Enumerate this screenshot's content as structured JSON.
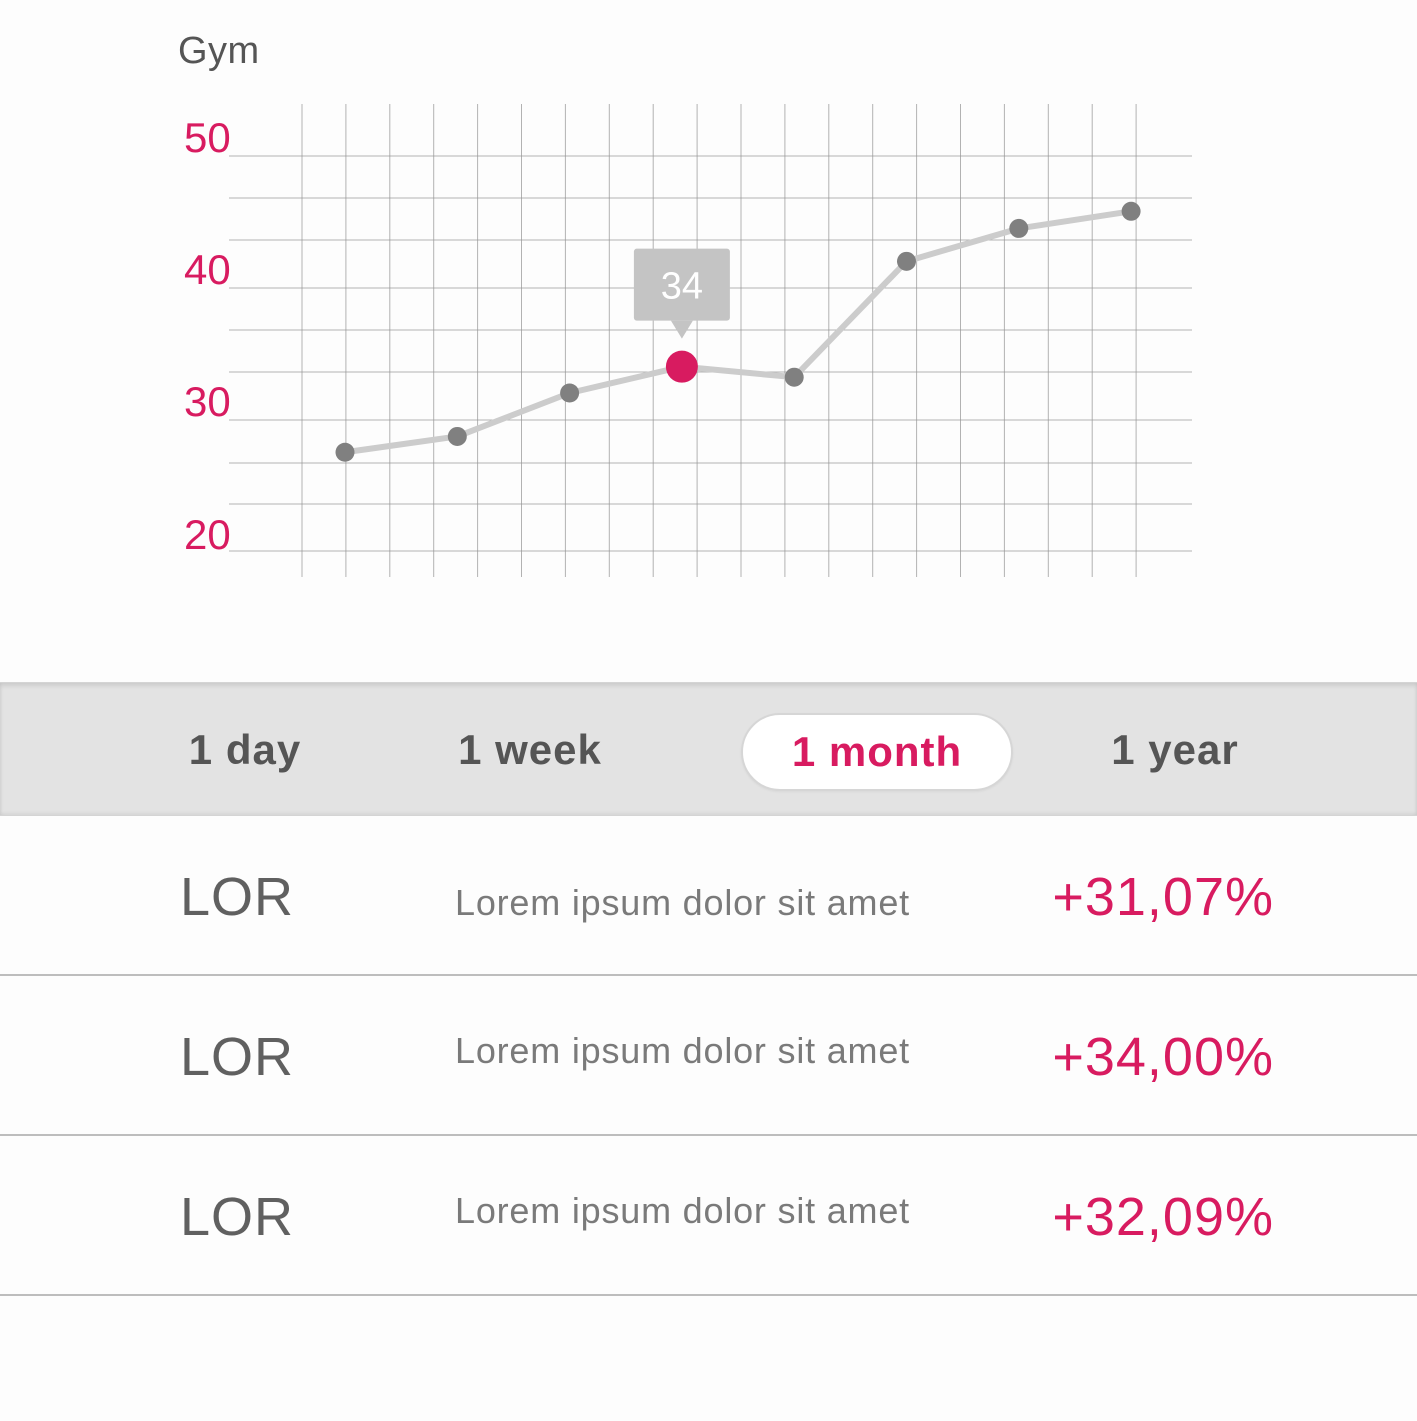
{
  "chart": {
    "title": "Gym",
    "accent_color": "#d81b60",
    "line_color": "#cccccc",
    "point_color": "#808080",
    "grid_color": "#999999"
  },
  "chart_data": {
    "type": "line",
    "title": "Gym",
    "xlabel": "",
    "ylabel": "",
    "y_ticks": [
      "50",
      "40",
      "30",
      "20"
    ],
    "ylim": [
      20,
      50
    ],
    "x": [
      1,
      2,
      3,
      4,
      5,
      6,
      7,
      8
    ],
    "values": [
      27.5,
      28.7,
      32.0,
      34.0,
      33.2,
      42.0,
      44.5,
      45.8
    ],
    "highlight_index": 3,
    "highlight_label": "34",
    "grid": true
  },
  "range_selector": {
    "tabs": [
      {
        "label": "1 day",
        "active": false
      },
      {
        "label": "1 week",
        "active": false
      },
      {
        "label": "1 month",
        "active": true
      },
      {
        "label": "1 year",
        "active": false
      }
    ]
  },
  "list": {
    "rows": [
      {
        "code": "LOR",
        "description": "Lorem ipsum dolor sit amet",
        "change": "+31,07%"
      },
      {
        "code": "LOR",
        "description": "Lorem ipsum dolor sit amet",
        "change": "+34,00%"
      },
      {
        "code": "LOR",
        "description": "Lorem ipsum dolor sit amet",
        "change": "+32,09%"
      }
    ]
  }
}
